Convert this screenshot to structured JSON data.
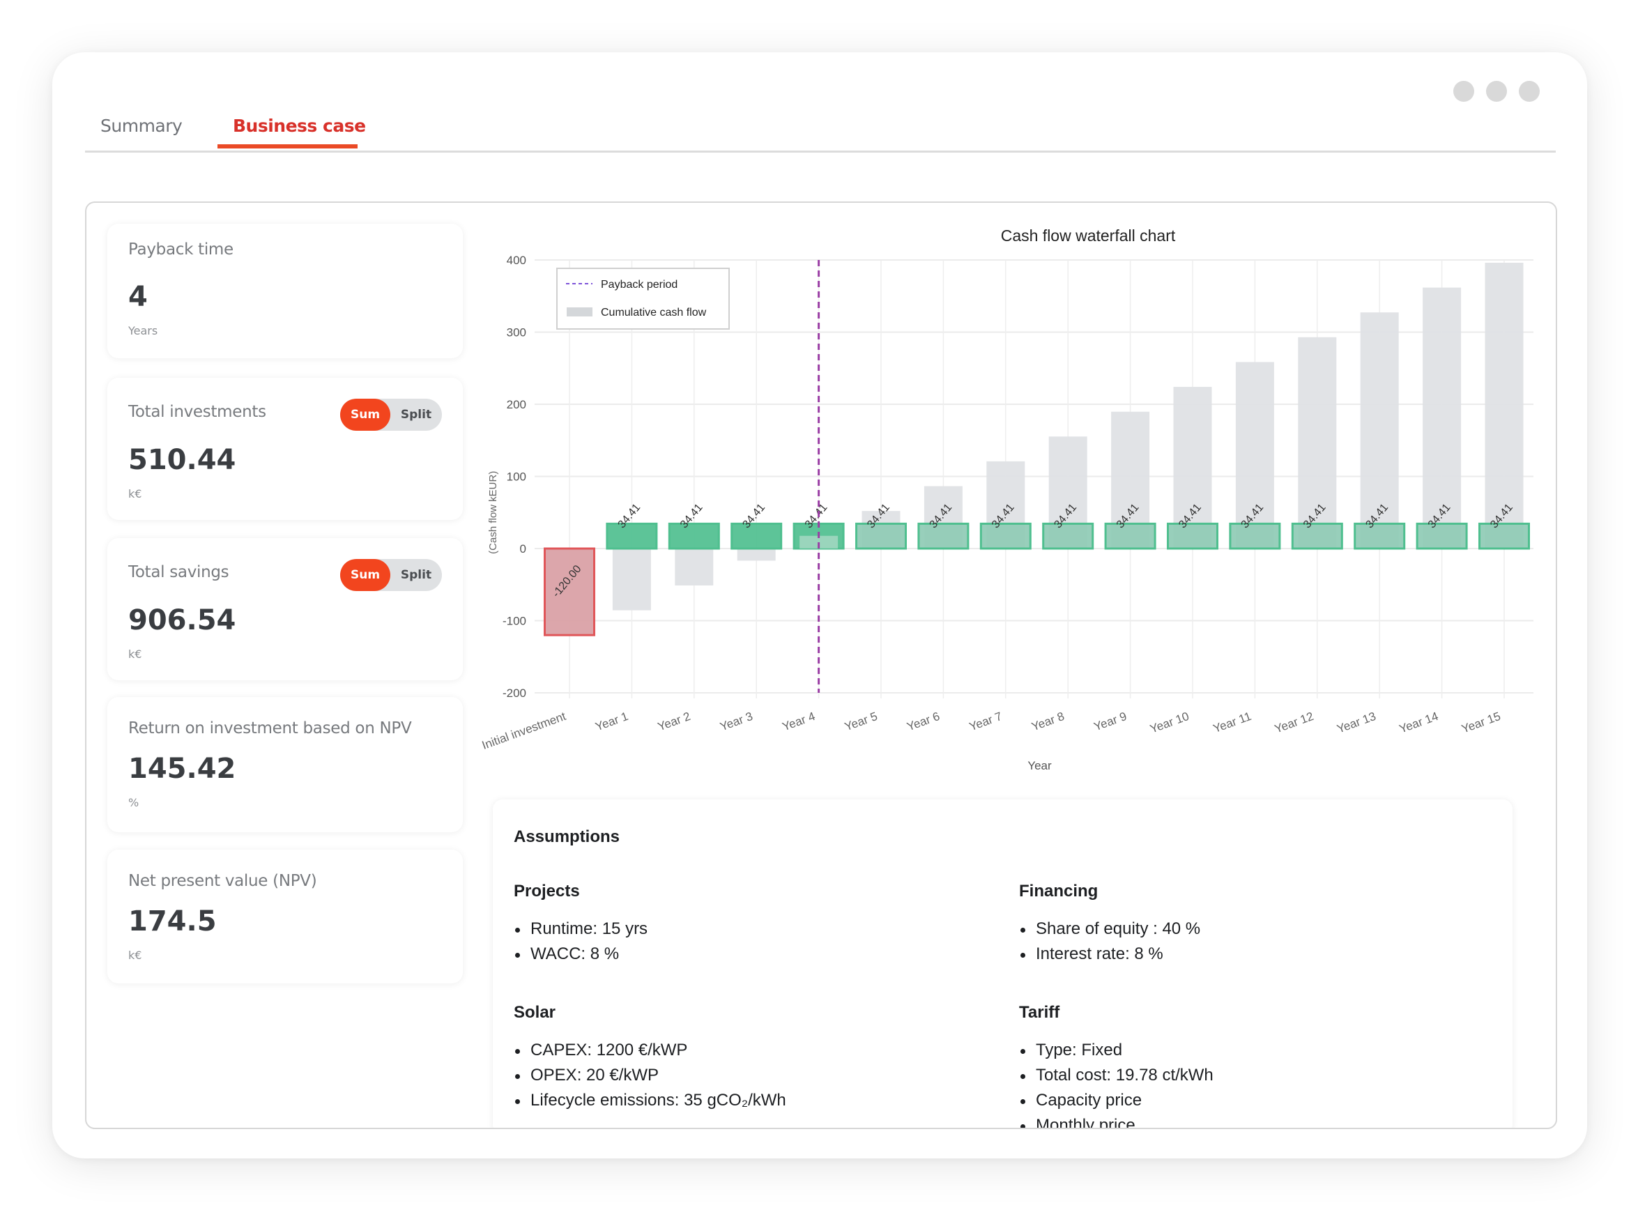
{
  "window": {
    "control_dots": [
      "dot-1",
      "dot-2",
      "dot-3"
    ]
  },
  "tabs": [
    {
      "label": "Summary",
      "active": false
    },
    {
      "label": "Business case",
      "active": true
    }
  ],
  "colors": {
    "accent": "#f2451e",
    "active_tab_text": "#d8312a",
    "positive_bar": "#4fbf8f",
    "positive_bar_after_payback": "#8fcbb5",
    "negative_bar": "#d99ea4",
    "negative_bar_edge": "#e05659",
    "cumulative_bar": "#dfe2e5",
    "payback_line": "#9b3fa5"
  },
  "kpis": [
    {
      "label": "Payback time",
      "value": "4",
      "unit": "Years",
      "has_toggle": false
    },
    {
      "label": "Total investments",
      "value": "510.44",
      "unit": "k€",
      "has_toggle": true,
      "toggle": {
        "options": [
          "Sum",
          "Split"
        ],
        "selected": "Sum"
      }
    },
    {
      "label": "Total savings",
      "value": "906.54",
      "unit": "k€",
      "has_toggle": true,
      "toggle": {
        "options": [
          "Sum",
          "Split"
        ],
        "selected": "Sum"
      }
    },
    {
      "label": "Return on investment based on NPV",
      "value": "145.42",
      "unit": "%",
      "has_toggle": false
    },
    {
      "label": "Net present value (NPV)",
      "value": "174.5",
      "unit": "k€",
      "has_toggle": false
    }
  ],
  "chart_data": {
    "type": "bar",
    "subtype": "waterfall",
    "title": "Cash flow waterfall chart",
    "xlabel": "Year",
    "ylabel": "(Cash flow kEUR)",
    "ylim": [
      -200,
      400
    ],
    "yticks": [
      400,
      300,
      200,
      100,
      0,
      -100,
      -200
    ],
    "grid": true,
    "legend": {
      "placement": "top-left",
      "entries": [
        {
          "label": "Payback period",
          "style": "dashed-line"
        },
        {
          "label": "Cumulative cash flow",
          "style": "gray-box"
        }
      ]
    },
    "categories": [
      "Initial investment",
      "Year 1",
      "Year 2",
      "Year 3",
      "Year 4",
      "Year 5",
      "Year 6",
      "Year 7",
      "Year 8",
      "Year 9",
      "Year 10",
      "Year 11",
      "Year 12",
      "Year 13",
      "Year 14",
      "Year 15"
    ],
    "series": [
      {
        "name": "Cash flow",
        "values": [
          -120.0,
          34.41,
          34.41,
          34.41,
          34.41,
          34.41,
          34.41,
          34.41,
          34.41,
          34.41,
          34.41,
          34.41,
          34.41,
          34.41,
          34.41,
          34.41
        ],
        "labels": [
          "-120.00",
          "34.41",
          "34.41",
          "34.41",
          "34.41",
          "34.41",
          "34.41",
          "34.41",
          "34.41",
          "34.41",
          "34.41",
          "34.41",
          "34.41",
          "34.41",
          "34.41",
          "34.41"
        ]
      },
      {
        "name": "Cumulative cash flow",
        "values": [
          -120.0,
          -85.59,
          -51.18,
          -16.77,
          17.64,
          52.05,
          86.46,
          120.87,
          155.28,
          189.69,
          224.1,
          258.51,
          292.92,
          327.33,
          361.74,
          396.15
        ]
      }
    ],
    "payback_period_category": "Year 4"
  },
  "assumptions": {
    "title": "Assumptions",
    "sections": [
      {
        "heading": "Projects",
        "items": [
          "Runtime: 15 yrs",
          "WACC: 8 %"
        ]
      },
      {
        "heading": "Financing",
        "items": [
          "Share of equity : 40 %",
          "Interest rate: 8 %"
        ]
      },
      {
        "heading": "Solar",
        "items": [
          "CAPEX: 1200 €/kWP",
          "OPEX: 20 €/kWP",
          "Lifecycle emissions: 35 gCO₂/kWh"
        ]
      },
      {
        "heading": "Tariff",
        "items": [
          "Type: Fixed",
          "Total cost: 19.78 ct/kWh",
          "Capacity price",
          "Monthly price"
        ]
      }
    ]
  }
}
